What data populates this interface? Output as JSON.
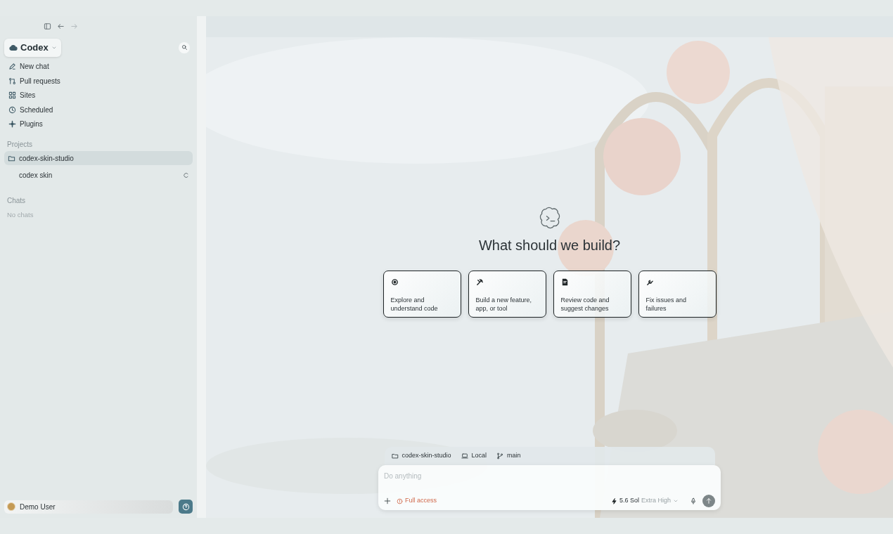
{
  "sidebar": {
    "workspace": "Codex",
    "nav": [
      {
        "label": "New chat"
      },
      {
        "label": "Pull requests"
      },
      {
        "label": "Sites"
      },
      {
        "label": "Scheduled"
      },
      {
        "label": "Plugins"
      }
    ],
    "projects_heading": "Projects",
    "projects": [
      {
        "label": "codex-skin-studio",
        "selected": true,
        "children": [
          {
            "label": "codex skin",
            "selected": false,
            "loading": true
          }
        ]
      }
    ],
    "chats_heading": "Chats",
    "chats_empty": "No chats",
    "user": {
      "name": "Demo User"
    }
  },
  "main": {
    "heading": "What should we build?",
    "suggestions": [
      {
        "text": "Explore and understand code"
      },
      {
        "text": "Build a new feature, app, or tool"
      },
      {
        "text": "Review code and suggest changes"
      },
      {
        "text": "Fix issues and failures"
      }
    ],
    "composer": {
      "context": [
        {
          "label": "codex-skin-studio"
        },
        {
          "label": "Local"
        },
        {
          "label": "main"
        }
      ],
      "placeholder": "Do anything",
      "access": "Full access",
      "model": "5.6 Sol",
      "effort": "Extra High"
    }
  }
}
